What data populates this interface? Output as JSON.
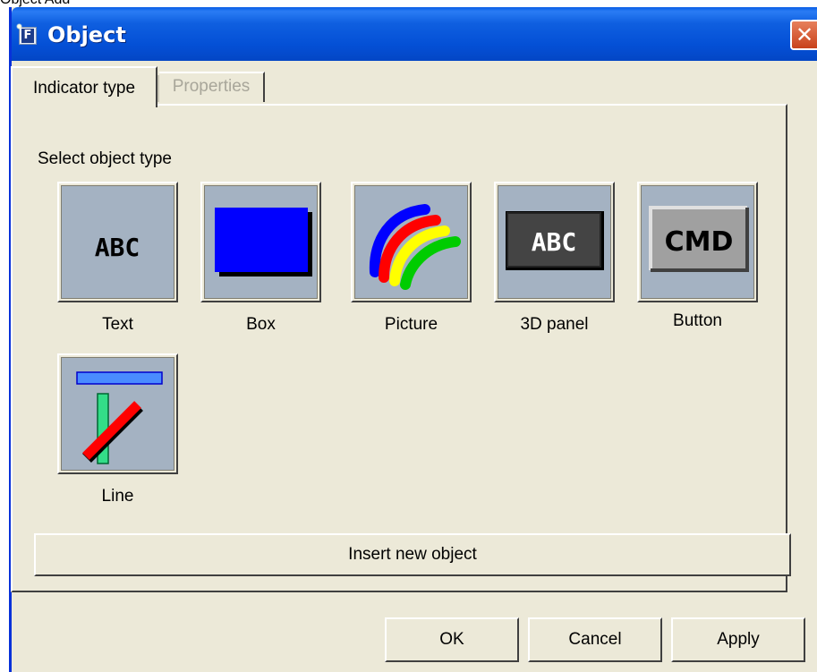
{
  "page_caption": "Object Add",
  "window": {
    "title": "Object",
    "close_symbol": "✕"
  },
  "tabs": [
    {
      "label": "Indicator type",
      "active": true
    },
    {
      "label": "Properties",
      "active": false
    }
  ],
  "section_label": "Select object type",
  "object_types": [
    {
      "label": "Text",
      "icon": "text-abc-icon",
      "icon_text": "ABC"
    },
    {
      "label": "Box",
      "icon": "box-icon"
    },
    {
      "label": "Picture",
      "icon": "picture-rainbow-icon"
    },
    {
      "label": "3D panel",
      "icon": "3d-panel-icon",
      "icon_text": "ABC"
    },
    {
      "label": "Button",
      "icon": "command-button-icon",
      "icon_text": "CMD"
    },
    {
      "label": "Line",
      "icon": "line-icon"
    }
  ],
  "insert_button_label": "Insert new object",
  "dialog_buttons": {
    "ok": "OK",
    "cancel": "Cancel",
    "apply": "Apply"
  },
  "colors": {
    "titlebar": "#0450d6",
    "dialog_bg": "#ece9d8",
    "tile_bg": "#a4b2c2",
    "box_fill": "#0000ff"
  }
}
